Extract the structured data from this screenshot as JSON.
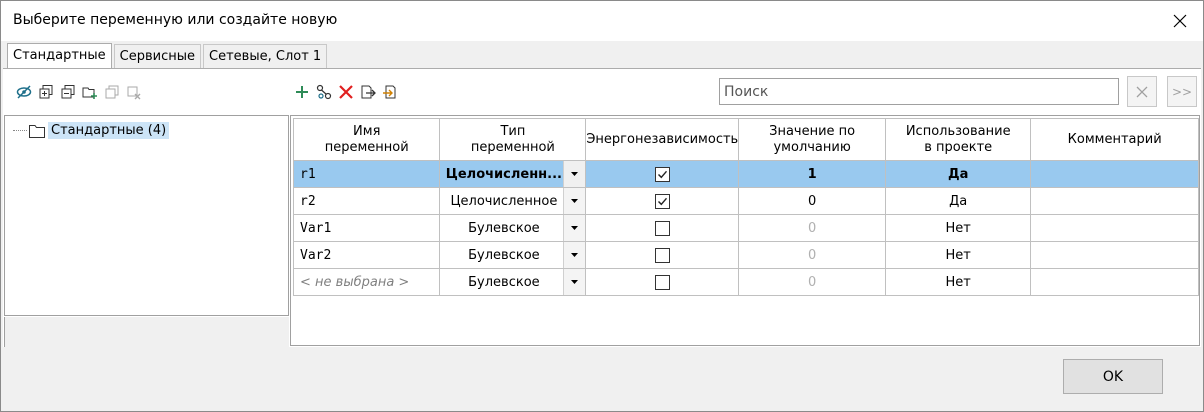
{
  "window": {
    "title": "Выберите переменную или создайте новую"
  },
  "tabs": [
    {
      "label": "Стандартные",
      "active": true
    },
    {
      "label": "Сервисные",
      "active": false
    },
    {
      "label": "Сетевые, Слот 1",
      "active": false
    }
  ],
  "toolbar_left": [
    {
      "icon": "show-hide-icon"
    },
    {
      "icon": "expand-all-icon"
    },
    {
      "icon": "collapse-all-icon"
    },
    {
      "icon": "add-folder-icon"
    },
    {
      "icon": "copy-folder-icon"
    },
    {
      "icon": "delete-folder-icon"
    }
  ],
  "toolbar_mid": [
    {
      "icon": "add-icon"
    },
    {
      "icon": "link-icon"
    },
    {
      "icon": "delete-icon"
    },
    {
      "icon": "export-icon"
    },
    {
      "icon": "import-icon"
    }
  ],
  "search": {
    "placeholder": "Поиск",
    "value": "",
    "next_label": ">>"
  },
  "tree": {
    "label": "Стандартные  (4)"
  },
  "grid": {
    "columns": [
      "Имя\nпеременной",
      "Тип\nпеременной",
      "Энергонезависимость",
      "Значение по\nумолчанию",
      "Использование\nв проекте",
      "Комментарий"
    ],
    "rows": [
      {
        "name": "r1",
        "type": "Целочисленн...",
        "nonvolatile": true,
        "default": "1",
        "used": "Да",
        "comment": "",
        "selected": true,
        "placeholder": false,
        "default_dim": false
      },
      {
        "name": "r2",
        "type": "Целочисленное",
        "nonvolatile": true,
        "default": "0",
        "used": "Да",
        "comment": "",
        "selected": false,
        "placeholder": false,
        "default_dim": false
      },
      {
        "name": "Var1",
        "type": "Булевское",
        "nonvolatile": false,
        "default": "0",
        "used": "Нет",
        "comment": "",
        "selected": false,
        "placeholder": false,
        "default_dim": true
      },
      {
        "name": "Var2",
        "type": "Булевское",
        "nonvolatile": false,
        "default": "0",
        "used": "Нет",
        "comment": "",
        "selected": false,
        "placeholder": false,
        "default_dim": true
      },
      {
        "name": "< не выбрана >",
        "type": "Булевское",
        "nonvolatile": false,
        "default": "0",
        "used": "Нет",
        "comment": "",
        "selected": false,
        "placeholder": true,
        "default_dim": true
      }
    ]
  },
  "footer": {
    "ok_label": "OK"
  }
}
